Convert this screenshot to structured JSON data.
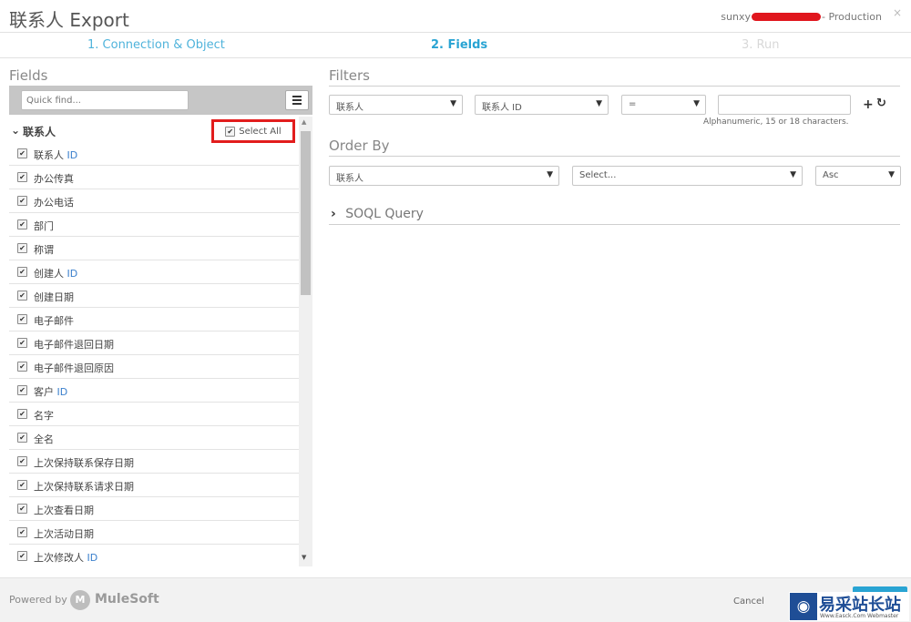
{
  "header": {
    "title": "联系人 Export",
    "user_prefix": "sunxy",
    "env": "- Production",
    "close": "×"
  },
  "steps": [
    {
      "label": "1. Connection & Object",
      "state": "done"
    },
    {
      "label": "2. Fields",
      "state": "active"
    },
    {
      "label": "3. Run",
      "state": "disabled"
    }
  ],
  "fields_panel": {
    "title": "Fields",
    "search_placeholder": "Quick find...",
    "group_name": "联系人",
    "select_all_label": "Select All",
    "select_all_checked": true,
    "items": [
      {
        "label": "联系人",
        "suffix": "ID",
        "checked": true
      },
      {
        "label": "办公传真",
        "suffix": "",
        "checked": true
      },
      {
        "label": "办公电话",
        "suffix": "",
        "checked": true
      },
      {
        "label": "部门",
        "suffix": "",
        "checked": true
      },
      {
        "label": "称谓",
        "suffix": "",
        "checked": true
      },
      {
        "label": "创建人",
        "suffix": "ID",
        "checked": true
      },
      {
        "label": "创建日期",
        "suffix": "",
        "checked": true
      },
      {
        "label": "电子邮件",
        "suffix": "",
        "checked": true
      },
      {
        "label": "电子邮件退回日期",
        "suffix": "",
        "checked": true
      },
      {
        "label": "电子邮件退回原因",
        "suffix": "",
        "checked": true
      },
      {
        "label": "客户",
        "suffix": "ID",
        "checked": true
      },
      {
        "label": "名字",
        "suffix": "",
        "checked": true
      },
      {
        "label": "全名",
        "suffix": "",
        "checked": true
      },
      {
        "label": "上次保持联系保存日期",
        "suffix": "",
        "checked": true
      },
      {
        "label": "上次保持联系请求日期",
        "suffix": "",
        "checked": true
      },
      {
        "label": "上次查看日期",
        "suffix": "",
        "checked": true
      },
      {
        "label": "上次活动日期",
        "suffix": "",
        "checked": true
      },
      {
        "label": "上次修改人",
        "suffix": "ID",
        "checked": true
      }
    ]
  },
  "filters": {
    "title": "Filters",
    "object": "联系人",
    "field": "联系人 ID",
    "operator": "=",
    "value": "",
    "hint": "Alphanumeric, 15 or 18 characters."
  },
  "order_by": {
    "title": "Order By",
    "object": "联系人",
    "field": "Select...",
    "direction": "Asc"
  },
  "soql": {
    "label": "SOQL Query"
  },
  "footer": {
    "powered_by": "Powered by",
    "brand": "MuleSoft",
    "cancel": "Cancel"
  },
  "watermark": {
    "text": "易采站长站",
    "sub": "Www.Easck.Com Webmaster"
  }
}
